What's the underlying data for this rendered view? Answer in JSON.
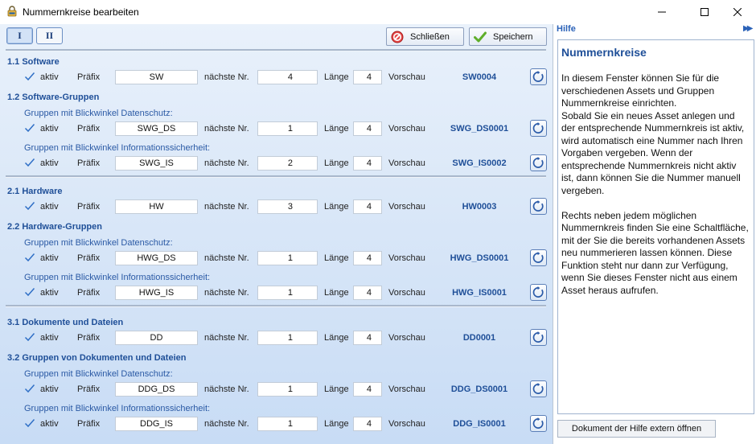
{
  "window": {
    "title": "Nummernkreise bearbeiten"
  },
  "tabs": [
    {
      "label": "I",
      "active": true
    },
    {
      "label": "II",
      "active": false
    }
  ],
  "toolbar": {
    "close_label": "Schließen",
    "save_label": "Speichern"
  },
  "labels": {
    "active": "aktiv",
    "prefix": "Präfix",
    "next_number": "nächste Nr.",
    "length": "Länge",
    "preview": "Vorschau"
  },
  "sections": {
    "software": {
      "title": "1.1 Software"
    },
    "software_groups": {
      "title": "1.2 Software-Gruppen",
      "group_ds": "Gruppen mit Blickwinkel Datenschutz:",
      "group_is": "Gruppen mit Blickwinkel Informationssicherheit:"
    },
    "hardware": {
      "title": "2.1 Hardware"
    },
    "hardware_groups": {
      "title": "2.2 Hardware-Gruppen",
      "group_ds": "Gruppen mit Blickwinkel Datenschutz:",
      "group_is": "Gruppen mit Blickwinkel Informationssicherheit:"
    },
    "documents": {
      "title": "3.1 Dokumente und Dateien"
    },
    "document_groups": {
      "title": "3.2 Gruppen von Dokumenten und Dateien",
      "group_ds": "Gruppen mit Blickwinkel Datenschutz:",
      "group_is": "Gruppen mit Blickwinkel Informationssicherheit:"
    }
  },
  "rows": {
    "sw": {
      "active": true,
      "prefix": "SW",
      "next": "4",
      "length": "4",
      "preview": "SW0004"
    },
    "swg_ds": {
      "active": true,
      "prefix": "SWG_DS",
      "next": "1",
      "length": "4",
      "preview": "SWG_DS0001"
    },
    "swg_is": {
      "active": true,
      "prefix": "SWG_IS",
      "next": "2",
      "length": "4",
      "preview": "SWG_IS0002"
    },
    "hw": {
      "active": true,
      "prefix": "HW",
      "next": "3",
      "length": "4",
      "preview": "HW0003"
    },
    "hwg_ds": {
      "active": true,
      "prefix": "HWG_DS",
      "next": "1",
      "length": "4",
      "preview": "HWG_DS0001"
    },
    "hwg_is": {
      "active": true,
      "prefix": "HWG_IS",
      "next": "1",
      "length": "4",
      "preview": "HWG_IS0001"
    },
    "dd": {
      "active": true,
      "prefix": "DD",
      "next": "1",
      "length": "4",
      "preview": "DD0001"
    },
    "ddg_ds": {
      "active": true,
      "prefix": "DDG_DS",
      "next": "1",
      "length": "4",
      "preview": "DDG_DS0001"
    },
    "ddg_is": {
      "active": true,
      "prefix": "DDG_IS",
      "next": "1",
      "length": "4",
      "preview": "DDG_IS0001"
    }
  },
  "help": {
    "header": "Hilfe",
    "title": "Nummernkreise",
    "text": "In diesem Fenster können Sie für die verschiedenen Assets und Gruppen Nummernkreise einrichten.\nSobald Sie ein neues Asset anlegen und der entsprechende Nummernkreis ist aktiv, wird automatisch eine Nummer nach Ihren Vorgaben vergeben. Wenn der entsprechende Nummernkreis nicht aktiv ist, dann können Sie die Nummer manuell vergeben.\n\nRechts neben jedem möglichen Nummernkreis finden Sie eine Schaltfläche, mit der Sie die bereits vorhandenen Assets neu nummerieren lassen können. Diese Funktion steht nur dann zur Verfügung, wenn Sie dieses Fenster nicht aus einem Asset heraus aufrufen.",
    "external_button": "Dokument der Hilfe extern öffnen"
  },
  "colors": {
    "accent": "#1f4f98",
    "group_label": "#2b5aa5",
    "pane_bg_top": "#e9f1fb",
    "pane_bg_bottom": "#c8dcf5"
  }
}
